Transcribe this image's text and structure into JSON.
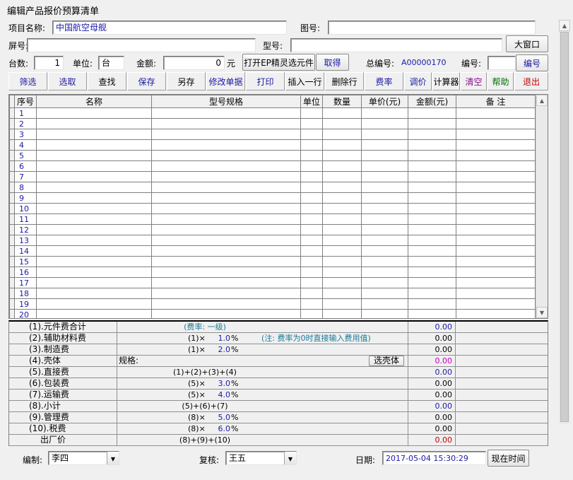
{
  "window": {
    "title": "编辑产品报价预算清单"
  },
  "form": {
    "project_label": "项目名称:",
    "project_value": "中国航空母舰",
    "drawing_label": "图号:",
    "drawing_value": "",
    "screen_label": "屏号:",
    "screen_value": "",
    "model_label": "型号:",
    "model_value": "",
    "big_window_btn": "大窗口",
    "count_label": "台数:",
    "count_value": "1",
    "unit_label": "单位:",
    "unit_value": "台",
    "amount_label": "金额:",
    "amount_value": "0",
    "amount_unit": "元",
    "open_ep_btn": "打开EP精灵选元件",
    "fetch_btn": "取得",
    "total_no_label": "总编号:",
    "total_no_value": "A00000170",
    "no_label": "编号:",
    "no_value": "",
    "no_btn": "编号"
  },
  "toolbar": [
    {
      "label": "筛选",
      "color": "#1a1aa6"
    },
    {
      "label": "选取",
      "color": "#1a1aa6"
    },
    {
      "label": "查找",
      "color": "#000000"
    },
    {
      "label": "保存",
      "color": "#1a1aa6"
    },
    {
      "label": "另存",
      "color": "#000000"
    },
    {
      "label": "修改单据",
      "color": "#1a1aa6"
    },
    {
      "label": "打印",
      "color": "#1a1aa6"
    },
    {
      "label": "插入一行",
      "color": "#000000"
    },
    {
      "label": "删除行",
      "color": "#000000"
    },
    {
      "label": "费率",
      "color": "#1a1aa6"
    },
    {
      "label": "调价",
      "color": "#1a1aa6"
    },
    {
      "label": "计算器",
      "color": "#000000"
    },
    {
      "label": "清空",
      "color": "#8a0f8a"
    },
    {
      "label": "帮助",
      "color": "#007000"
    },
    {
      "label": "退出",
      "color": "#c00000"
    }
  ],
  "grid": {
    "columns": [
      "序号",
      "名称",
      "型号规格",
      "单位",
      "数量",
      "单价(元)",
      "金额(元)",
      "备  注"
    ],
    "rows": [
      "1",
      "2",
      "3",
      "4",
      "5",
      "6",
      "7",
      "8",
      "9",
      "10",
      "11",
      "12",
      "13",
      "14",
      "15",
      "16",
      "17",
      "18",
      "19",
      "20"
    ]
  },
  "fees": [
    {
      "label": "(1).元件费合计",
      "formula": "(费率: 一级)",
      "value": "0.00",
      "value_color": "#1a1aa6"
    },
    {
      "label": "(2).辅助材料费",
      "formula": "(1)×",
      "rate": "1.0",
      "pct": "%",
      "note": "(注: 费率为0时直接输入费用值)",
      "value": "0.00",
      "value_color": "#000000"
    },
    {
      "label": "(3).制造费",
      "formula": "(1)×",
      "rate": "2.0",
      "pct": "%",
      "value": "0.00",
      "value_color": "#000000"
    },
    {
      "label": "(4).壳体",
      "spec_label": "规格:",
      "shell_btn": "选壳体",
      "value": "0.00",
      "value_color": "#c000c0"
    },
    {
      "label": "(5).直接费",
      "formula": "(1)+(2)+(3)+(4)",
      "value": "0.00",
      "value_color": "#1a1aa6"
    },
    {
      "label": "(6).包装费",
      "formula": "(5)×",
      "rate": "3.0",
      "pct": "%",
      "value": "0.00",
      "value_color": "#000000"
    },
    {
      "label": "(7).运输费",
      "formula": "(5)×",
      "rate": "4.0",
      "pct": "%",
      "value": "0.00",
      "value_color": "#000000"
    },
    {
      "label": "(8).小计",
      "formula": "(5)+(6)+(7)",
      "value": "0.00",
      "value_color": "#1a1aa6"
    },
    {
      "label": "(9).管理费",
      "formula": "(8)×",
      "rate": "5.0",
      "pct": "%",
      "value": "0.00",
      "value_color": "#000000"
    },
    {
      "label": "(10).税费",
      "formula": "(8)×",
      "rate": "6.0",
      "pct": "%",
      "value": "0.00",
      "value_color": "#000000"
    },
    {
      "label": "出厂价",
      "formula": "(8)+(9)+(10)",
      "value": "0.00",
      "value_color": "#c00000"
    }
  ],
  "footer": {
    "editor_label": "编制:",
    "editor_value": "李四",
    "reviewer_label": "复核:",
    "reviewer_value": "王五",
    "date_label": "日期:",
    "date_value": "2017-05-04 15:30:29",
    "now_btn": "现在时间"
  }
}
